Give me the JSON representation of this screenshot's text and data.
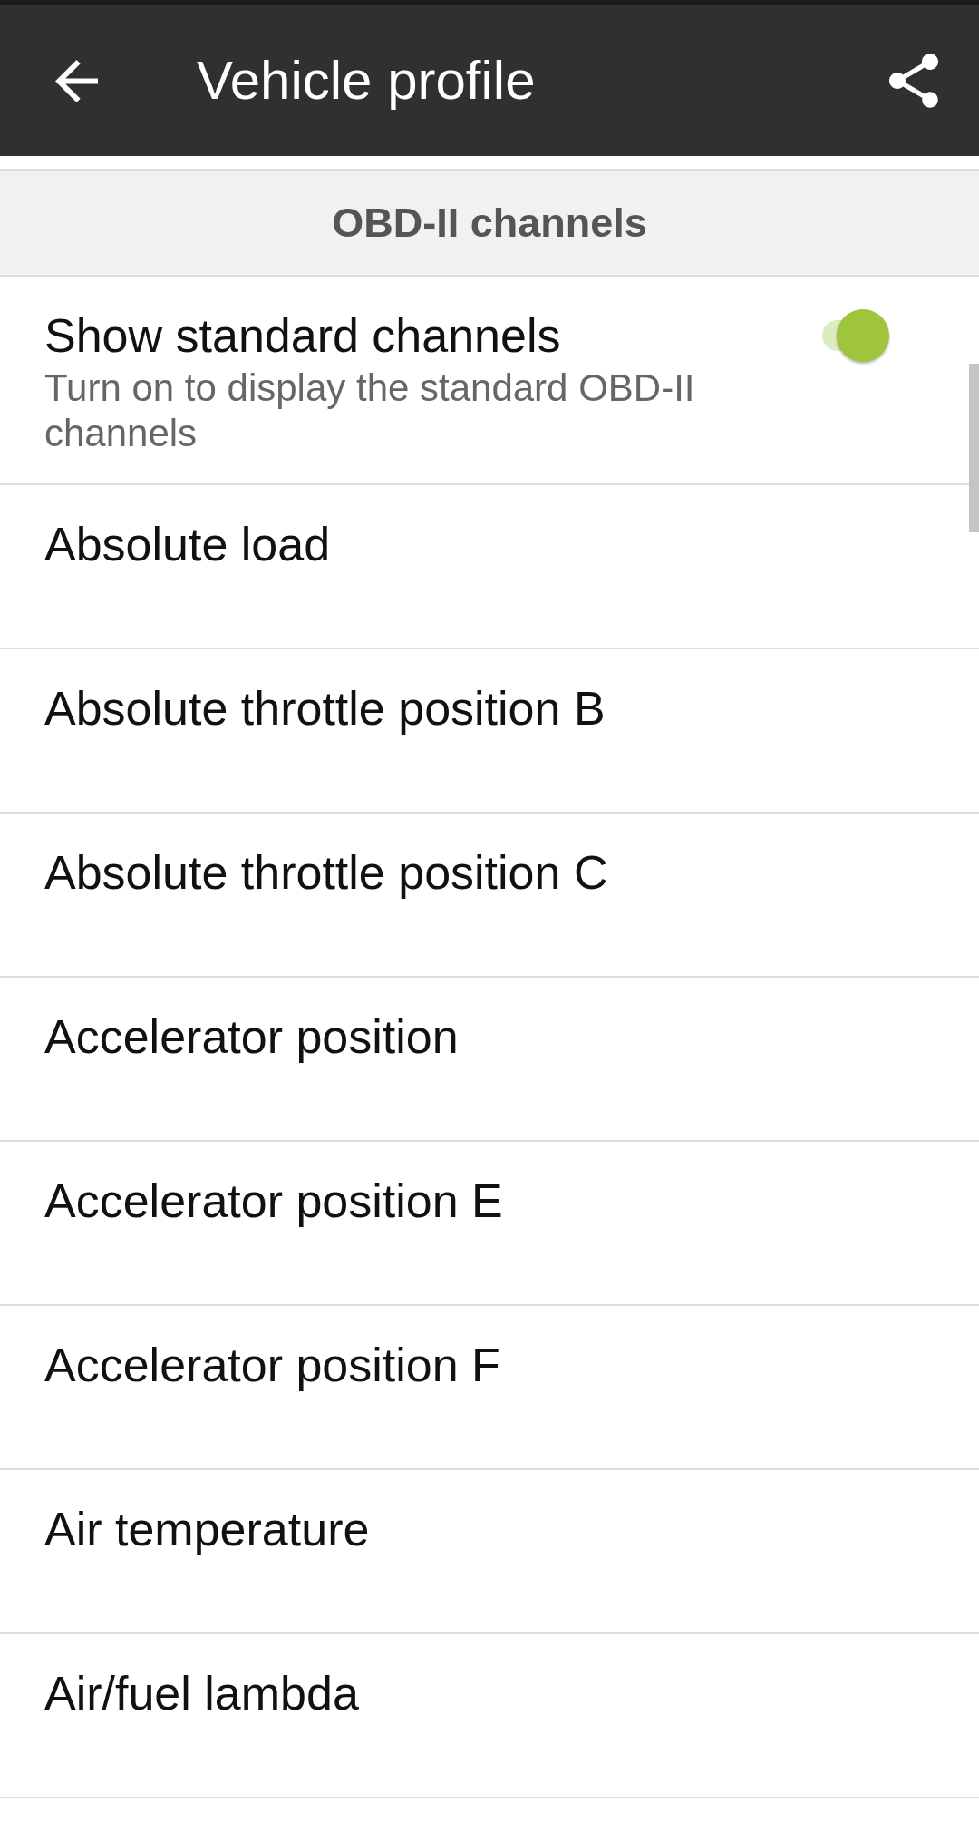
{
  "app_bar": {
    "title": "Vehicle profile"
  },
  "section": {
    "title": "OBD-II channels"
  },
  "standard_channels": {
    "title": "Show standard channels",
    "description": "Turn on to display the standard OBD-II channels",
    "on": true
  },
  "channels": [
    {
      "name": "Absolute load"
    },
    {
      "name": "Absolute throttle position B"
    },
    {
      "name": "Absolute throttle position C"
    },
    {
      "name": "Accelerator position"
    },
    {
      "name": "Accelerator position E"
    },
    {
      "name": "Accelerator position F"
    },
    {
      "name": "Air temperature"
    },
    {
      "name": "Air/fuel lambda"
    }
  ]
}
